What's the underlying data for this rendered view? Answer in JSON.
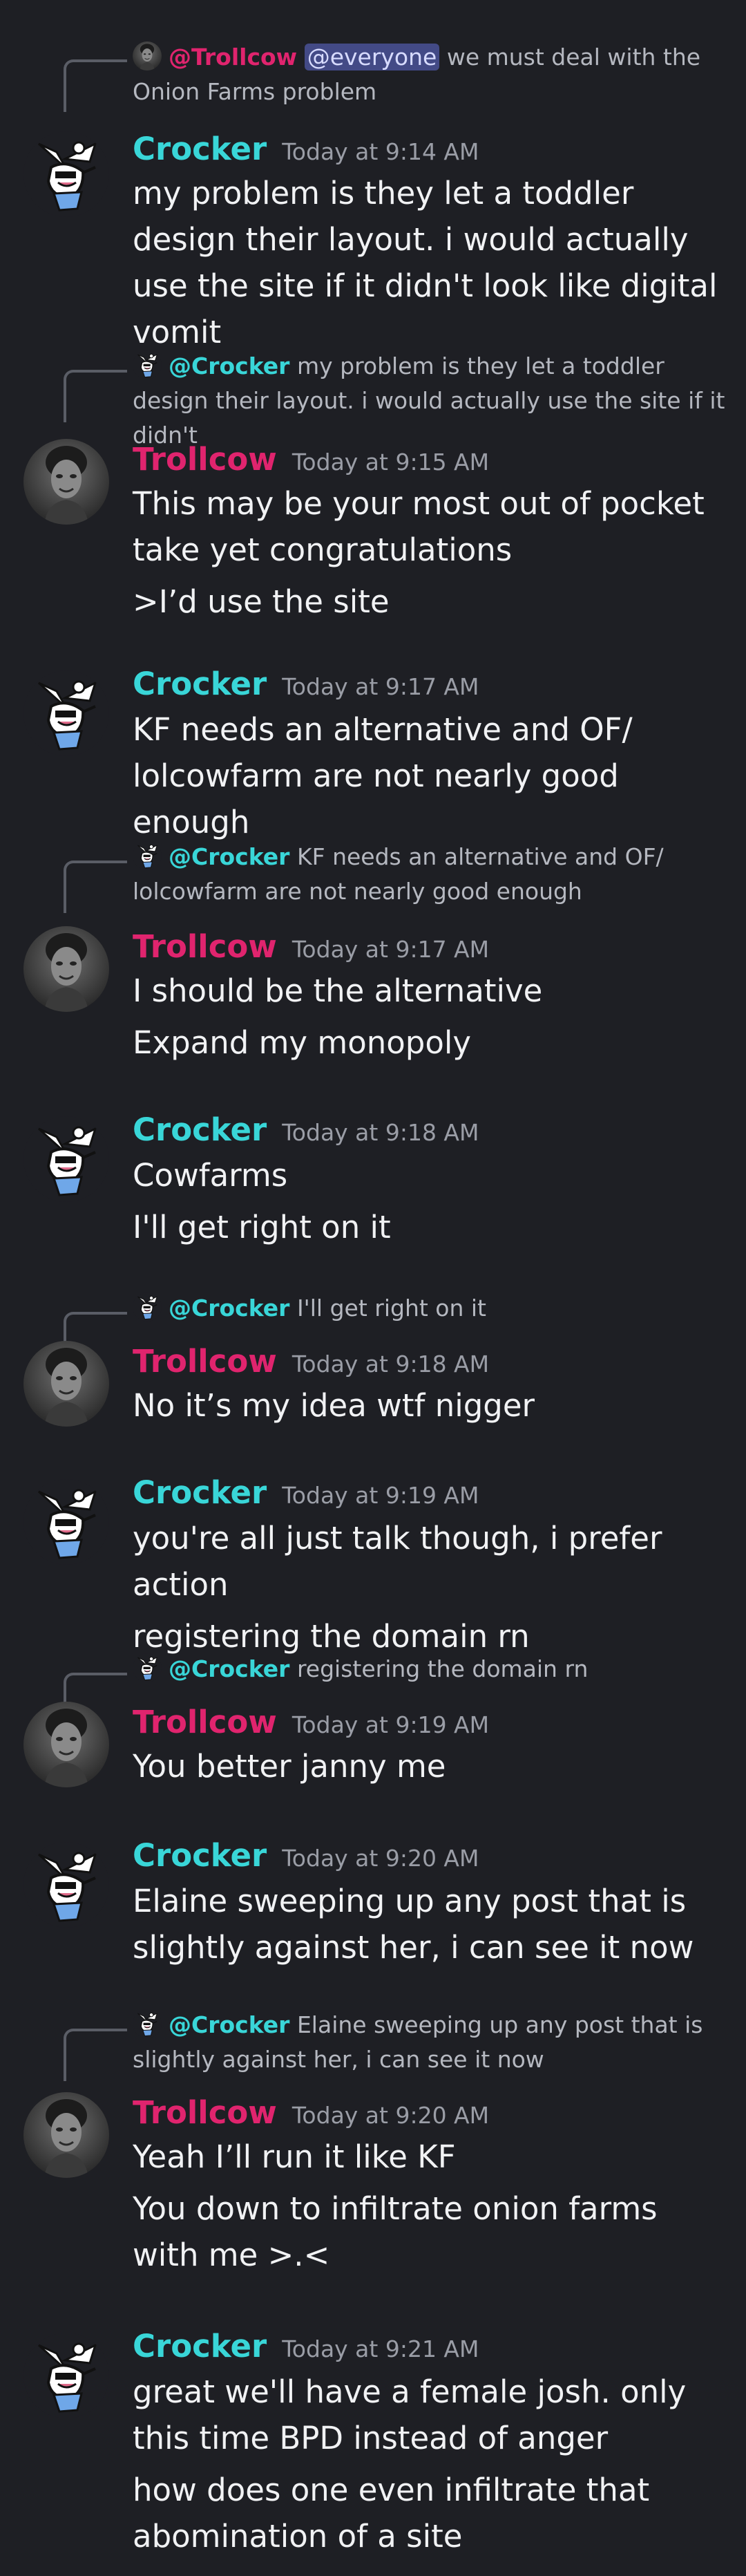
{
  "colors": {
    "background": "#1e1f24",
    "crocker": "#39d6d8",
    "trollcow": "#e0246e",
    "everyone_bg": "#434a86"
  },
  "messages": [
    {
      "reply": {
        "mention": "@Trollcow",
        "mention2": "@everyone",
        "text": "we must deal with the Onion Farms problem"
      },
      "author": "Crocker",
      "time": "Today at 9:14 AM",
      "lines": [
        "my problem is they let a toddler design their layout. i would actually use the site if it didn't look like digital vomit"
      ]
    },
    {
      "reply": {
        "mention": "@Crocker",
        "text": "my problem is they let a toddler design their layout. i would actually use the site if it didn't"
      },
      "author": "Trollcow",
      "time": "Today at 9:15 AM",
      "lines": [
        "This may be your most out of pocket take yet congratulations",
        ">I’d use the site"
      ]
    },
    {
      "author": "Crocker",
      "time": "Today at 9:17 AM",
      "lines": [
        "KF needs an alternative and OF/ lolcowfarm are not nearly good enough"
      ]
    },
    {
      "reply": {
        "mention": "@Crocker",
        "text": "KF needs an alternative and OF/ lolcowfarm are not nearly good enough"
      },
      "author": "Trollcow",
      "time": "Today at 9:17 AM",
      "lines": [
        "I should be the alternative",
        "Expand my monopoly"
      ]
    },
    {
      "author": "Crocker",
      "time": "Today at 9:18 AM",
      "lines": [
        "Cowfarms",
        "I'll get right on it"
      ]
    },
    {
      "reply": {
        "mention": "@Crocker",
        "text": "I'll get right on it"
      },
      "author": "Trollcow",
      "time": "Today at 9:18 AM",
      "lines": [
        "No it’s my idea wtf nigger"
      ]
    },
    {
      "author": "Crocker",
      "time": "Today at 9:19 AM",
      "lines": [
        "you're all just talk though, i prefer action",
        "registering the domain rn"
      ]
    },
    {
      "reply": {
        "mention": "@Crocker",
        "text": "registering the domain rn"
      },
      "author": "Trollcow",
      "time": "Today at 9:19 AM",
      "lines": [
        "You better janny me"
      ]
    },
    {
      "author": "Crocker",
      "time": "Today at 9:20 AM",
      "lines": [
        "Elaine sweeping up any post that is slightly against her, i can see it now"
      ]
    },
    {
      "reply": {
        "mention": "@Crocker",
        "text": "Elaine sweeping up any post that is slightly against her, i can see it now"
      },
      "author": "Trollcow",
      "time": "Today at 9:20 AM",
      "lines": [
        "Yeah I’ll run it like KF",
        "You down to infiltrate onion farms with me >.<"
      ]
    },
    {
      "author": "Crocker",
      "time": "Today at 9:21 AM",
      "lines": [
        "great we'll have a female josh. only this time BPD instead of anger",
        "how does one even infiltrate that abomination of a site"
      ]
    }
  ]
}
